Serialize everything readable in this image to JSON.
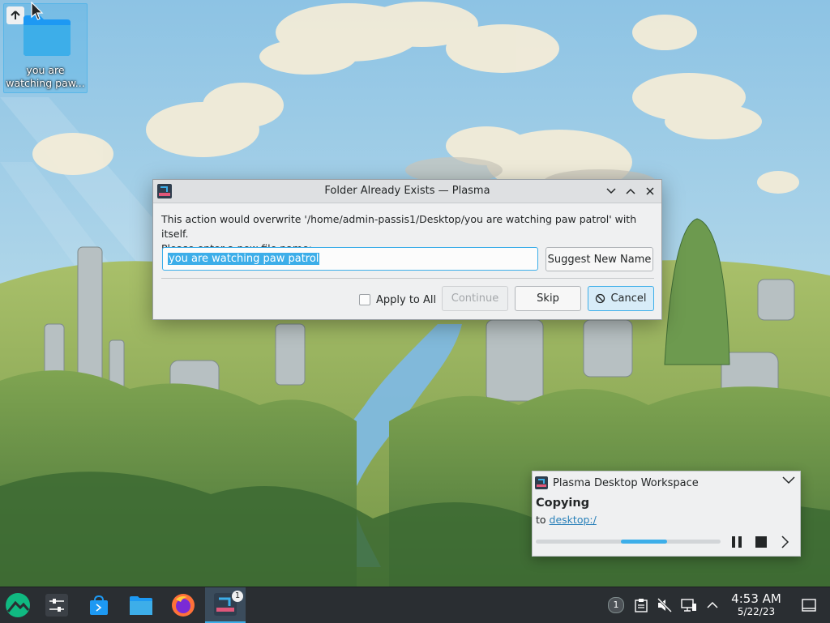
{
  "desktop": {
    "icon_label": "you are watching paw..."
  },
  "dialog": {
    "title": "Folder Already Exists — Plasma",
    "message_line1": "This action would overwrite '/home/admin-passis1/Desktop/you are watching paw patrol' with itself.",
    "message_line2": "Please enter a new file name:",
    "input_value": "you are watching paw patrol",
    "suggest_label": "Suggest New Name",
    "apply_all_label": "Apply to All",
    "continue_label": "Continue",
    "skip_label": "Skip",
    "cancel_label": "Cancel"
  },
  "notification": {
    "app_name": "Plasma Desktop Workspace",
    "title": "Copying",
    "to_prefix": "to",
    "destination": "desktop:/",
    "progress_fraction": 0.25
  },
  "taskbar": {
    "task_badge": "1",
    "tray_badge": "1",
    "time": "4:53 AM",
    "date": "5/22/23"
  },
  "colors": {
    "accent": "#3daee9",
    "taskbar": "#2a2e32",
    "dialog_bg": "#eff0f1"
  }
}
